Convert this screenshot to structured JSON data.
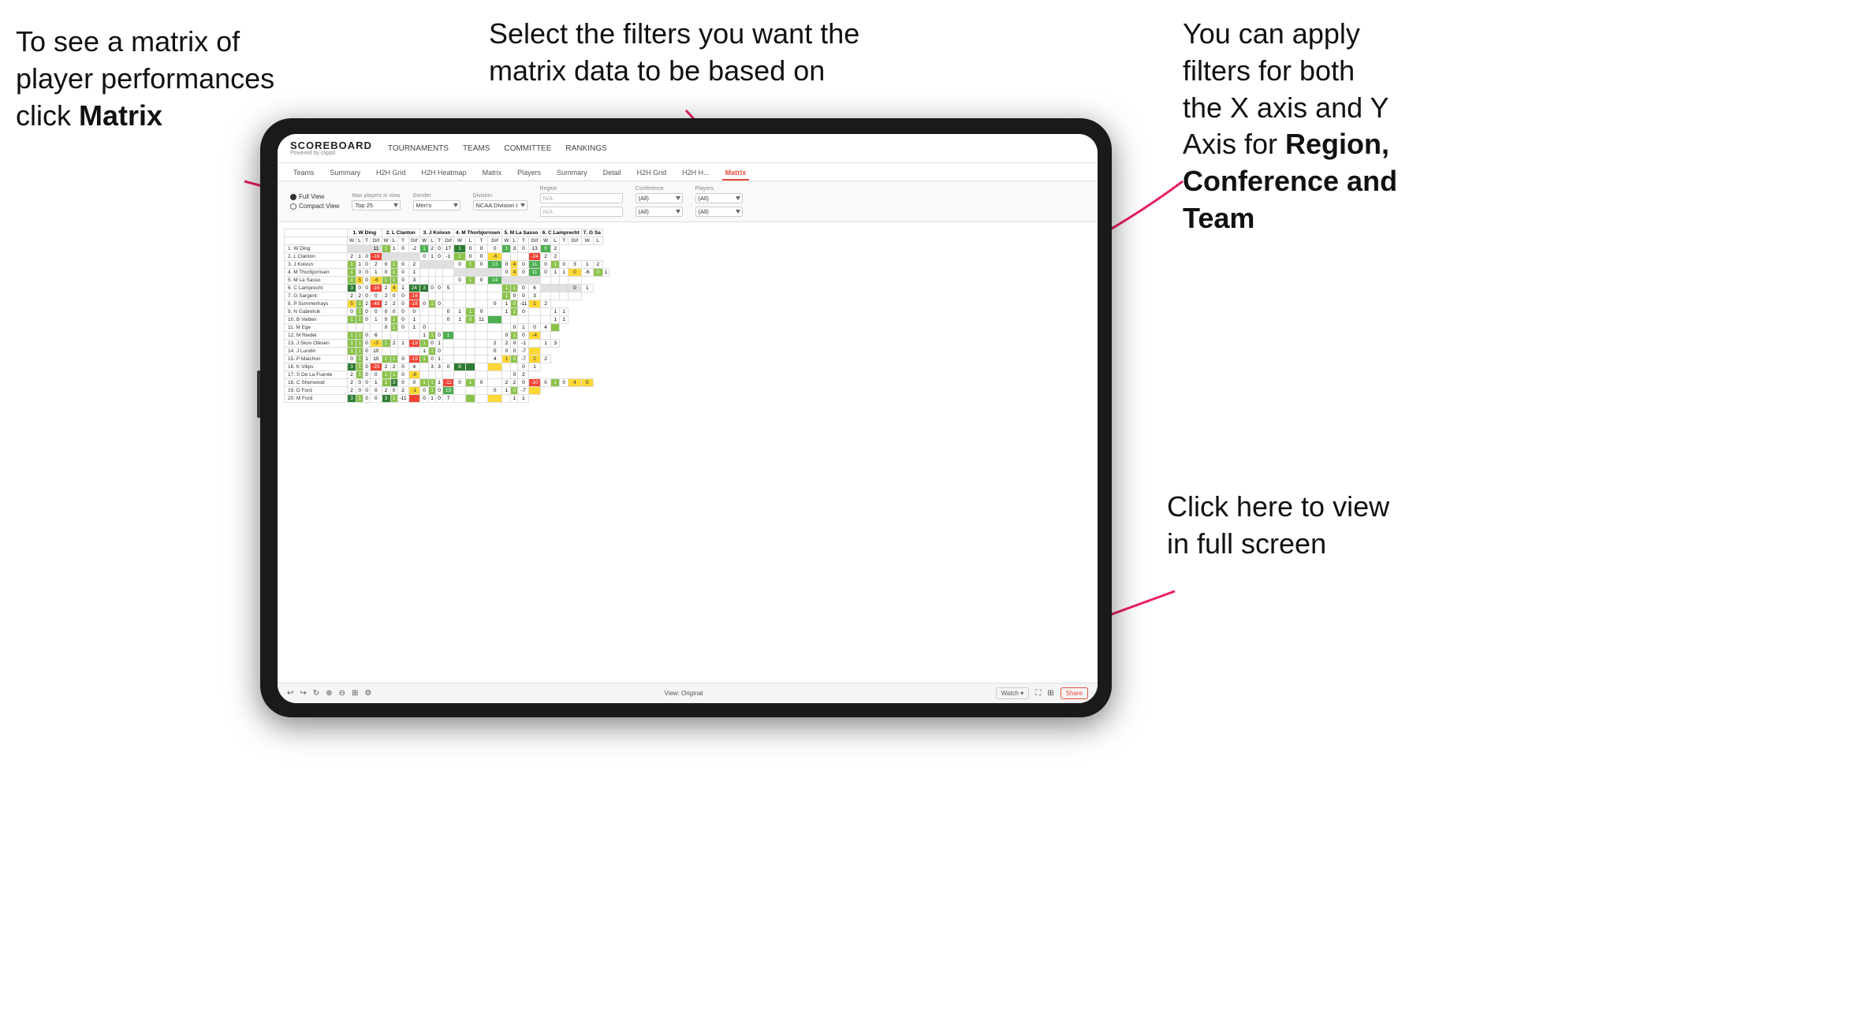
{
  "annotations": {
    "top_left": {
      "line1": "To see a matrix of",
      "line2": "player performances",
      "line3_prefix": "click ",
      "line3_bold": "Matrix"
    },
    "top_center": {
      "text": "Select the filters you want the matrix data to be based on"
    },
    "top_right": {
      "line1": "You  can apply",
      "line2": "filters for both",
      "line3": "the X axis and Y",
      "line4_prefix": "Axis for ",
      "line4_bold": "Region,",
      "line5_bold": "Conference and",
      "line6_bold": "Team"
    },
    "bottom_right": {
      "line1": "Click here to view",
      "line2": "in full screen"
    }
  },
  "app": {
    "logo_main": "SCOREBOARD",
    "logo_sub": "Powered by clippd",
    "nav": [
      "TOURNAMENTS",
      "TEAMS",
      "COMMITTEE",
      "RANKINGS"
    ],
    "sub_nav": [
      "Teams",
      "Summary",
      "H2H Grid",
      "H2H Heatmap",
      "Matrix",
      "Players",
      "Summary",
      "Detail",
      "H2H Grid",
      "H2H H...",
      "Matrix"
    ],
    "active_tab": "Matrix",
    "filters": {
      "view_options": [
        "Full View",
        "Compact View"
      ],
      "max_players_label": "Max players in view",
      "max_players_value": "Top 25",
      "gender_label": "Gender",
      "gender_value": "Men's",
      "division_label": "Division",
      "division_value": "NCAA Division I",
      "region_label": "Region",
      "region_value": "N/A",
      "conference_label": "Conference",
      "conference_value": "(All)",
      "players_label": "Players",
      "players_value": "(All)"
    },
    "column_headers": [
      "1. W Ding",
      "2. L Clanton",
      "3. J Koivun",
      "4. M Thorbjornsen",
      "5. M La Sasso",
      "6. C Lamprecht",
      "7. G Sa"
    ],
    "sub_cols": [
      "W",
      "L",
      "T",
      "Dif"
    ],
    "rows": [
      {
        "name": "1. W Ding",
        "data": [
          "",
          "",
          "",
          "11",
          "1",
          "1",
          "0",
          "-2",
          "1",
          "2",
          "0",
          "17",
          "1",
          "0",
          "0",
          "0",
          "1",
          "3",
          "0",
          "13",
          "0",
          "2"
        ]
      },
      {
        "name": "2. L Clanton",
        "data": [
          "2",
          "1",
          "0",
          "-16",
          "",
          "",
          "",
          "",
          "0",
          "1",
          "0",
          "-1",
          "1",
          "0",
          "0",
          "-6",
          "",
          "",
          "",
          "-24",
          "2",
          "2"
        ]
      },
      {
        "name": "3. J Koivun",
        "data": [
          "1",
          "1",
          "0",
          "2",
          "0",
          "1",
          "0",
          "2",
          "",
          "",
          "",
          "",
          "0",
          "1",
          "0",
          "13",
          "0",
          "4",
          "0",
          "11",
          "0",
          "1",
          "0",
          "3",
          "1",
          "2"
        ]
      },
      {
        "name": "4. M Thorbjornsen",
        "data": [
          "1",
          "0",
          "0",
          "1",
          "0",
          "1",
          "0",
          "1",
          "",
          "",
          "",
          "",
          "",
          "",
          "",
          "",
          "0",
          "4",
          "0",
          "11",
          "0",
          "1",
          "1",
          "0",
          "-6",
          "0",
          "1"
        ]
      },
      {
        "name": "5. M La Sasso",
        "data": [
          "1",
          "5",
          "0",
          "-6",
          "1",
          "1",
          "0",
          "3",
          "",
          "",
          "",
          "",
          "0",
          "1",
          "0",
          "14",
          "",
          "",
          "",
          "",
          "",
          "",
          "",
          ""
        ]
      },
      {
        "name": "6. C Lamprecht",
        "data": [
          "3",
          "0",
          "0",
          "-16",
          "2",
          "4",
          "1",
          "24",
          "3",
          "0",
          "0",
          "5",
          "",
          "",
          "",
          "",
          "1",
          "1",
          "0",
          "6",
          "",
          "",
          "",
          "0",
          "1"
        ]
      },
      {
        "name": "7. G Sargent",
        "data": [
          "2",
          "2",
          "0",
          "0",
          "2",
          "0",
          "0",
          "-16",
          "",
          "",
          "",
          "",
          "",
          "",
          "",
          "",
          "1",
          "0",
          "0",
          "3",
          "",
          "",
          "",
          ""
        ]
      },
      {
        "name": "8. P Summerhays",
        "data": [
          "5",
          "1",
          "2",
          "-48",
          "2",
          "2",
          "0",
          "-16",
          "0",
          "1",
          "0",
          "",
          "",
          "",
          "",
          "0",
          "1",
          "0",
          "-11",
          "1",
          "2"
        ]
      },
      {
        "name": "9. N Gabrelcik",
        "data": [
          "0",
          "1",
          "0",
          "0",
          "0",
          "0",
          "0",
          "0",
          "",
          "",
          "",
          "0",
          "1",
          "1",
          "0",
          "",
          "1",
          "1",
          "0",
          "",
          "",
          "1",
          "1"
        ]
      },
      {
        "name": "10. B Valdes",
        "data": [
          "1",
          "1",
          "0",
          "1",
          "0",
          "1",
          "0",
          "1",
          "",
          "",
          "",
          "0",
          "1",
          "0",
          "11",
          "",
          "",
          "",
          "",
          "",
          "",
          "1",
          "1"
        ]
      },
      {
        "name": "11. M Ege",
        "data": [
          "",
          "",
          "",
          "",
          "0",
          "1",
          "0",
          "1",
          "0",
          "",
          "",
          "",
          "",
          "",
          "",
          "",
          "",
          "0",
          "1",
          "0",
          "4",
          ""
        ]
      },
      {
        "name": "12. M Riedel",
        "data": [
          "1",
          "1",
          "0",
          "6",
          "",
          "",
          "",
          "",
          "1",
          "1",
          "0",
          "1",
          "",
          "",
          "",
          "",
          "0",
          "1",
          "0",
          "-4",
          ""
        ]
      },
      {
        "name": "13. J Skov Olesen",
        "data": [
          "1",
          "1",
          "0",
          "-3",
          "1",
          "2",
          "1",
          "-19",
          "1",
          "0",
          "1",
          "",
          "",
          "",
          "",
          "2",
          "2",
          "0",
          "-1",
          "",
          "1",
          "3"
        ]
      },
      {
        "name": "14. J Lundin",
        "data": [
          "1",
          "1",
          "0",
          "10",
          "",
          "",
          "",
          "",
          "1",
          "1",
          "0",
          "",
          "",
          "",
          "",
          "0",
          "0",
          "0",
          "-7",
          ""
        ]
      },
      {
        "name": "15. P Maichon",
        "data": [
          "0",
          "1",
          "1",
          "10",
          "1",
          "1",
          "0",
          "-19",
          "1",
          "0",
          "1",
          "",
          "",
          "",
          "",
          "4",
          "1",
          "0",
          "-7",
          "2",
          "2"
        ]
      },
      {
        "name": "16. K Vilips",
        "data": [
          "3",
          "1",
          "0",
          "-25",
          "2",
          "2",
          "0",
          "4",
          "",
          "3",
          "3",
          "0",
          "8",
          "",
          "",
          "",
          "",
          "",
          "0",
          "1"
        ]
      },
      {
        "name": "17. S De La Fuente",
        "data": [
          "2",
          "1",
          "0",
          "0",
          "1",
          "1",
          "0",
          "-8",
          "",
          "",
          "",
          "",
          "",
          "",
          "",
          "",
          "",
          "0",
          "2"
        ]
      },
      {
        "name": "18. C Sherwood",
        "data": [
          "2",
          "0",
          "0",
          "1",
          "1",
          "3",
          "0",
          "0",
          "1",
          "1",
          "1",
          "-11",
          "0",
          "1",
          "0",
          "",
          "2",
          "2",
          "0",
          "-10",
          "0",
          "1",
          "0",
          "4",
          "5"
        ]
      },
      {
        "name": "19. D Ford",
        "data": [
          "2",
          "0",
          "0",
          "0",
          "2",
          "0",
          "2",
          "-1",
          "0",
          "1",
          "0",
          "13",
          "",
          "",
          "",
          "0",
          "1",
          "0",
          "-7",
          ""
        ]
      },
      {
        "name": "20. M Ford",
        "data": [
          "3",
          "1",
          "0",
          "0",
          "3",
          "1",
          "-11",
          "",
          "0",
          "1",
          "0",
          "7",
          "",
          "",
          "",
          "",
          "",
          "1",
          "1"
        ]
      }
    ]
  },
  "toolbar": {
    "view_label": "View: Original",
    "watch_label": "Watch ▾",
    "share_label": "Share"
  }
}
